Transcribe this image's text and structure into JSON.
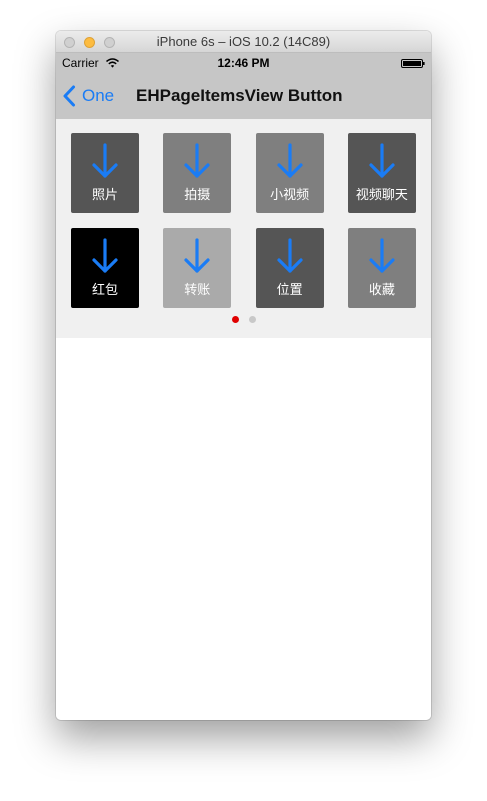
{
  "window": {
    "title": "iPhone 6s – iOS 10.2 (14C89)"
  },
  "status_bar": {
    "carrier": "Carrier",
    "time": "12:46 PM"
  },
  "nav": {
    "back_label": "One",
    "title": "EHPageItemsView Button"
  },
  "items": [
    {
      "label": "照片",
      "bg": "#555555",
      "icon": "arrow-down-icon"
    },
    {
      "label": "拍摄",
      "bg": "#7f7f7f",
      "icon": "arrow-down-icon"
    },
    {
      "label": "小视频",
      "bg": "#7f7f7f",
      "icon": "arrow-down-icon"
    },
    {
      "label": "视频聊天",
      "bg": "#555555",
      "icon": "arrow-down-icon"
    },
    {
      "label": "红包",
      "bg": "#000000",
      "icon": "arrow-down-icon"
    },
    {
      "label": "转账",
      "bg": "#aaaaaa",
      "icon": "arrow-down-icon"
    },
    {
      "label": "位置",
      "bg": "#555555",
      "icon": "arrow-down-icon"
    },
    {
      "label": "收藏",
      "bg": "#7f7f7f",
      "icon": "arrow-down-icon"
    }
  ],
  "page_control": {
    "pages": 2,
    "current": 0,
    "active_color": "#e00000",
    "inactive_color": "#c8c8c8"
  },
  "colors": {
    "accent": "#1a7cf5"
  }
}
